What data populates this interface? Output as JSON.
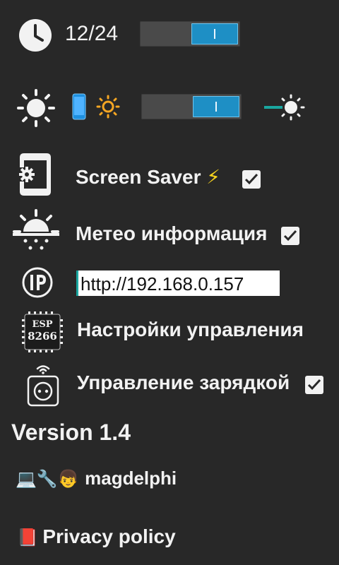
{
  "clock_format": {
    "value": "12/24",
    "toggle_on": true
  },
  "brightness": {
    "toggle_on": true
  },
  "screen_saver": {
    "label": "Screen Saver",
    "bolt": "⚡",
    "checked": true
  },
  "meteo": {
    "label": "Метео информация",
    "checked": true
  },
  "ip": {
    "value": "http://192.168.0.157"
  },
  "esp": {
    "chip_line1": "ESP",
    "chip_line2": "8266",
    "label": "Настройки управления"
  },
  "charging": {
    "label": "Управление зарядкой",
    "checked": true
  },
  "version": "Version 1.4",
  "author": {
    "emojis": "💻🔧👦",
    "name": "magdelphi"
  },
  "privacy": {
    "emoji": "📕",
    "label": "Privacy policy"
  },
  "colors": {
    "background": "#282828",
    "accent": "#1e8fc5",
    "sun_orange": "#f5a623",
    "phone_blue": "#1e90e0"
  }
}
